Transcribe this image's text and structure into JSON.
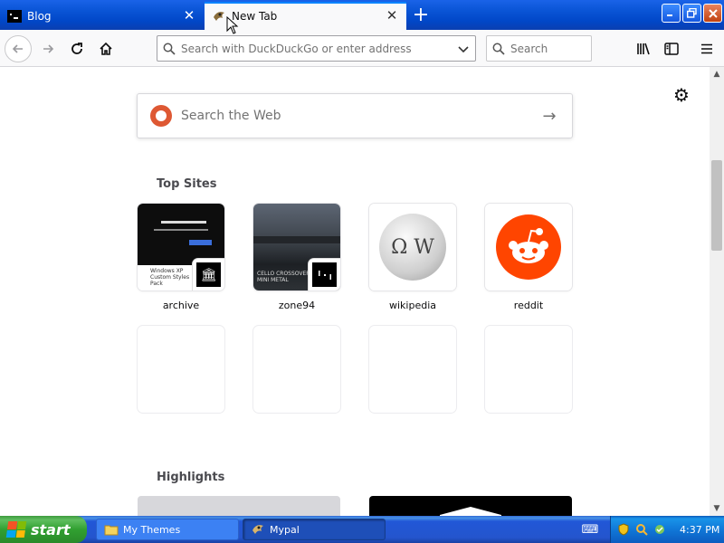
{
  "tabs": [
    {
      "title": "Blog"
    },
    {
      "title": "New Tab"
    }
  ],
  "toolbar": {
    "url_placeholder": "Search with DuckDuckGo or enter address",
    "search_placeholder": "Search"
  },
  "newtab": {
    "web_search_placeholder": "Search the Web",
    "top_sites_heading": "Top Sites",
    "highlights_heading": "Highlights",
    "top_sites": [
      {
        "label": "archive"
      },
      {
        "label": "zone94"
      },
      {
        "label": "wikipedia"
      },
      {
        "label": "reddit"
      }
    ],
    "thumb_text": {
      "archive_caption": "Windows XP Custom Styles Pack",
      "zone94_caption": "CELLO CROSSOVER MINI METAL"
    }
  },
  "taskbar": {
    "start_label": "start",
    "tasks": [
      {
        "label": "My Themes"
      },
      {
        "label": "Mypal"
      }
    ],
    "clock": "4:37 PM"
  },
  "colors": {
    "xp_blue": "#0a55d6",
    "tab_accent": "#0a84ff",
    "reddit": "#ff4500",
    "duckduckgo": "#de5833",
    "start_green": "#31a031"
  }
}
